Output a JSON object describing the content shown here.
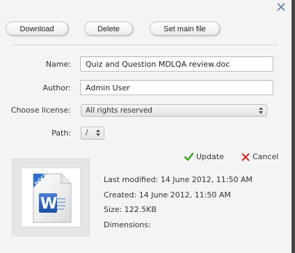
{
  "dialog": {
    "close_icon": "close-icon"
  },
  "toolbar": {
    "download_label": "Download",
    "delete_label": "Delete",
    "set_main_label": "Set main file"
  },
  "form": {
    "name_label": "Name:",
    "name_value": "Quiz and Question MDLQA review.doc",
    "author_label": "Author:",
    "author_value": "Admin User",
    "license_label": "Choose license:",
    "license_value": "All rights reserved",
    "path_label": "Path:",
    "path_value": "/"
  },
  "actions": {
    "update_label": "Update",
    "cancel_label": "Cancel",
    "update_icon": "checkmark-icon",
    "cancel_icon": "cross-icon",
    "update_color": "#3aa41e",
    "cancel_color": "#d92020"
  },
  "file_info": {
    "icon": "word-docx-file-icon",
    "last_modified": "Last modified: 14 June 2012, 11:50 AM",
    "created": "Created: 14 June 2012, 11:50 AM",
    "size": "Size: 122.5KB",
    "dimensions": "Dimensions:"
  }
}
